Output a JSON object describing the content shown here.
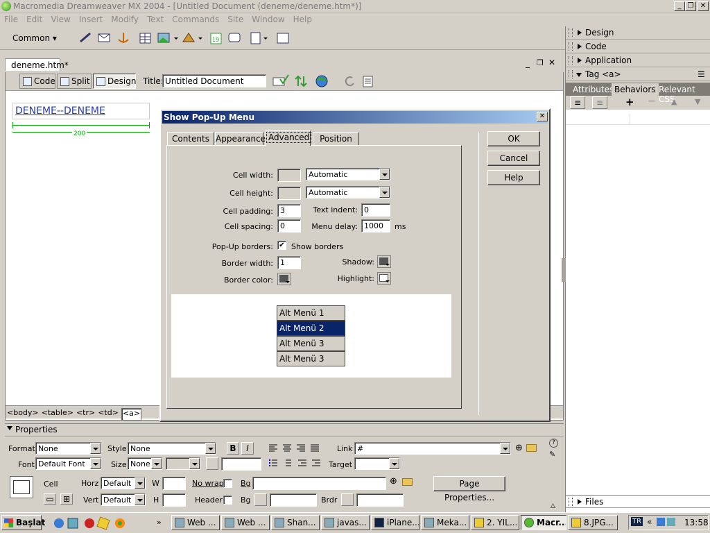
{
  "window": {
    "title": "Macromedia Dreamweaver MX 2004 - [Untitled Document (deneme/deneme.htm*)]"
  },
  "menu": [
    "File",
    "Edit",
    "View",
    "Insert",
    "Modify",
    "Text",
    "Commands",
    "Site",
    "Window",
    "Help"
  ],
  "insert_bar": {
    "category": "Common"
  },
  "document": {
    "tab": "deneme.htm*",
    "views": [
      "Code",
      "Split",
      "Design"
    ],
    "title_label": "Title:",
    "title_value": "Untitled Document",
    "content_text": "DENEME--DENEME",
    "width_label": "200"
  },
  "status_tags": [
    "<body>",
    "<table>",
    "<tr>",
    "<td>",
    "<a>"
  ],
  "panels": {
    "design": "Design",
    "code": "Code",
    "application": "Application",
    "tag": "Tag <a>",
    "tabs": [
      "Attributes",
      "Behaviors",
      "Relevant CSS"
    ],
    "files": "Files"
  },
  "properties": {
    "title": "Properties",
    "format_label": "Format",
    "format_value": "None",
    "style_label": "Style",
    "style_value": "None",
    "bold": "B",
    "italic": "I",
    "link_label": "Link",
    "link_value": "#",
    "font_label": "Font",
    "font_value": "Default Font",
    "size_label": "Size",
    "size_value": "None",
    "target_label": "Target",
    "cell_label": "Cell",
    "horz_label": "Horz",
    "horz_value": "Default",
    "vert_label": "Vert",
    "vert_value": "Default",
    "w_label": "W",
    "h_label": "H",
    "nowrap_label": "No wrap",
    "header_label": "Header",
    "bg_label": "Bg",
    "bg2_label": "Bg",
    "brdr_label": "Brdr",
    "page_properties": "Page Properties..."
  },
  "dialog": {
    "title": "Show Pop-Up Menu",
    "tabs": [
      "Contents",
      "Appearance",
      "Advanced",
      "Position"
    ],
    "buttons": [
      "OK",
      "Cancel",
      "Help"
    ],
    "cell_width_label": "Cell width:",
    "cell_width_mode": "Automatic",
    "cell_height_label": "Cell height:",
    "cell_height_mode": "Automatic",
    "cell_padding_label": "Cell padding:",
    "cell_padding": "3",
    "text_indent_label": "Text indent:",
    "text_indent": "0",
    "cell_spacing_label": "Cell spacing:",
    "cell_spacing": "0",
    "menu_delay_label": "Menu delay:",
    "menu_delay": "1000",
    "ms": "ms",
    "popup_borders_label": "Pop-Up borders:",
    "show_borders": "Show borders",
    "border_width_label": "Border width:",
    "border_width": "1",
    "shadow_label": "Shadow:",
    "border_color_label": "Border color:",
    "highlight_label": "Highlight:",
    "preview_items": [
      "Alt Menü 1",
      "Alt Menü 2",
      "Alt Menü 3",
      "Alt Menü 3"
    ]
  },
  "taskbar": {
    "start": "Başlat",
    "tasks": [
      "Web ...",
      "Web ...",
      "Shan...",
      "javas...",
      "iPlane...",
      "Meka...",
      "2. YIL...",
      "Macr...",
      "8.JPG..."
    ],
    "lang": "TR",
    "clock": "13:58"
  }
}
